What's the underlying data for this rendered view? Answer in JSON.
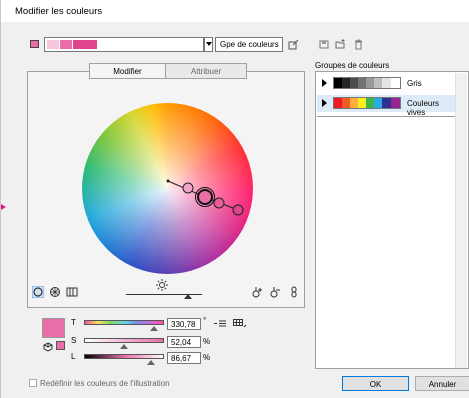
{
  "window": {
    "title": "Modifier les couleurs"
  },
  "toolbar": {
    "group_name": "Gpe de couleurs",
    "active_swatch_color": "#e86da9",
    "bar_colors": [
      "#f4c7dc",
      "#e86da9",
      "#e0448f",
      "#f2a7c9"
    ]
  },
  "tabs": {
    "edit": "Modifier",
    "assign": "Attribuer"
  },
  "right_panel": {
    "title": "Groupes de couleurs",
    "groups": [
      {
        "name": "Gris",
        "colors": [
          "#000000",
          "#262626",
          "#4d4d4d",
          "#737373",
          "#999999",
          "#bfbfbf",
          "#e6e6e6",
          "#ffffff"
        ]
      },
      {
        "name": "Couleurs vives",
        "colors": [
          "#ed1c24",
          "#f15a24",
          "#fbb03b",
          "#fcee21",
          "#39b54a",
          "#29abe2",
          "#2e3192",
          "#93278f"
        ]
      }
    ]
  },
  "sliders": {
    "preview_color": "#e86da9",
    "t_label": "T",
    "t_value": "330,78",
    "t_unit": "°",
    "s_label": "S",
    "s_value": "52,04",
    "s_unit": "%",
    "l_label": "L",
    "l_value": "86,67",
    "l_unit": "%"
  },
  "footer": {
    "recolor_label": "Redéfinir les couleurs de l'illustration",
    "ok_label": "OK",
    "cancel_label": "Annuler"
  }
}
